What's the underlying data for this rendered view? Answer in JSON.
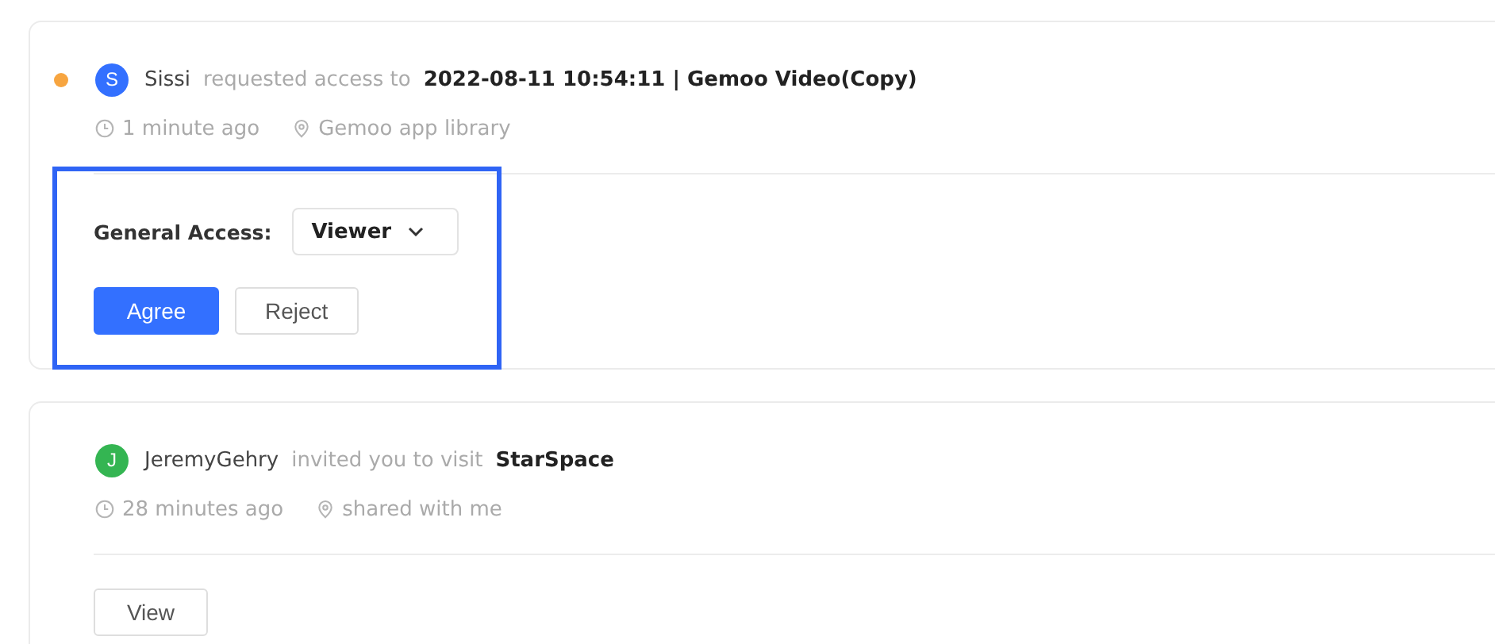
{
  "notifications": [
    {
      "kind": "access_request",
      "unread": true,
      "highlighted": true,
      "avatar": {
        "letter": "S",
        "color": "#3370ff"
      },
      "user": "Sissi",
      "action": "requested access to",
      "target": "2022-08-11 10:54:11 | Gemoo Video(Copy)",
      "time": "1 minute ago",
      "location": "Gemoo app library",
      "access": {
        "label": "General Access:",
        "value": "Viewer"
      },
      "buttons": [
        {
          "label": "Agree",
          "primary": true
        },
        {
          "label": "Reject",
          "primary": false
        }
      ]
    },
    {
      "kind": "invite",
      "unread": false,
      "highlighted": false,
      "avatar": {
        "letter": "J",
        "color": "#34b552"
      },
      "user": "JeremyGehry",
      "action": "invited you to visit",
      "target": "StarSpace",
      "time": "28 minutes ago",
      "location": "shared with me",
      "buttons": [
        {
          "label": "View",
          "primary": false
        }
      ]
    }
  ]
}
